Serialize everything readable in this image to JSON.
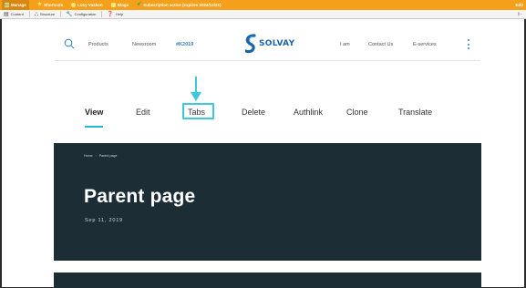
{
  "admin_bar": {
    "items": [
      {
        "label": "Manage",
        "icon": "menu-icon"
      },
      {
        "label": "Shortcuts",
        "icon": "star-icon"
      },
      {
        "label": "Lucy Vaskon",
        "icon": "user-icon"
      },
      {
        "label": "Blogs",
        "icon": "tag-icon"
      },
      {
        "label": "Subscription active (expires 2024/12/21)",
        "icon": "check-icon"
      }
    ],
    "edit_label": "Edit"
  },
  "sub_bar": {
    "items": [
      {
        "label": "Content",
        "icon": "content-icon"
      },
      {
        "label": "Structure",
        "icon": "structure-icon"
      },
      {
        "label": "Configuration",
        "icon": "wrench-icon"
      },
      {
        "label": "Help",
        "icon": "help-icon"
      }
    ],
    "right_label": "[|←"
  },
  "header": {
    "links": [
      "Products",
      "Newsroom",
      "#K2019"
    ],
    "logo_text": "SOLVAY",
    "right_links": [
      "I am",
      "Contact Us",
      "E-services"
    ]
  },
  "tabs": {
    "items": [
      "View",
      "Edit",
      "Tabs",
      "Delete",
      "Authlink",
      "Clone",
      "Translate"
    ],
    "active": "View",
    "highlighted": "Tabs"
  },
  "hero": {
    "breadcrumb": [
      "Home",
      "Parent page"
    ],
    "title": "Parent page",
    "date": "Sep 11, 2019"
  },
  "colors": {
    "admin_orange": "#f5a01a",
    "hero_bg": "#1d2d35",
    "accent_cyan": "#3ac9e0",
    "brand_blue": "#1c63ad"
  }
}
